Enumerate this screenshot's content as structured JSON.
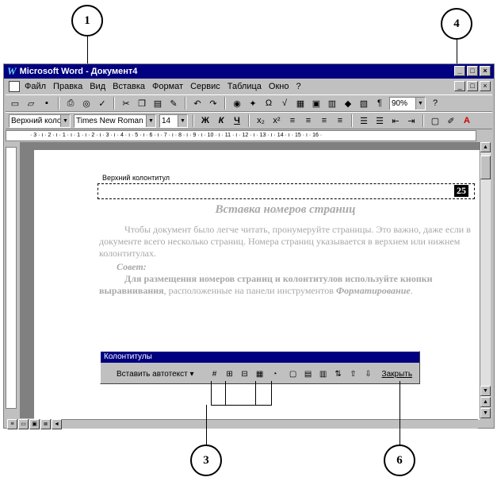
{
  "window": {
    "title": "Microsoft Word - Документ4",
    "logo": "W",
    "controls": [
      "_",
      "□",
      "×"
    ]
  },
  "menu": [
    "Файл",
    "Правка",
    "Вид",
    "Вставка",
    "Формат",
    "Сервис",
    "Таблица",
    "Окно",
    "?"
  ],
  "standard_toolbar": {
    "zoom": "90%"
  },
  "formatting_toolbar": {
    "style": "Верхний колонт",
    "font": "Times New Roman",
    "size": "14",
    "bold": "Ж",
    "italic": "К",
    "underline": "Ч"
  },
  "ruler_text": "· 3 · ı · 2 · ı · 1 · ı · 1 · ı · 2 · ı · 3 · ı · 4 · ı · 5 · ı · 6 · ı · 7 · ı · 8 · ı · 9 · ı · 10 · ı · 11 · ı · 12 · ı · 13 · ı · 14 · ı · 15 · ı · 16 ·",
  "document": {
    "header_label": "Верхний колонтитул",
    "page_number": "25",
    "heading": "Вставка номеров страниц",
    "paragraph1": "Чтобы документ было легче читать, пронумеруйте страницы. Это важно, даже если в документе всего несколько страниц. Номера страниц указывается в верхнем или нижнем колонтитулах.",
    "advice": "Совет:",
    "paragraph2_a": "Для размещения номеров страниц и колонтитулов используйте кнопки выравнивания",
    "paragraph2_b": ", расположенные на панели инструментов ",
    "paragraph2_c": "Форматирование",
    "paragraph2_d": "."
  },
  "hf_toolbar": {
    "title": "Колонтитулы",
    "insert_autotext": "Вставить автотекст",
    "close": "Закрыть"
  },
  "callouts": [
    "1",
    "4",
    "3",
    "6"
  ]
}
